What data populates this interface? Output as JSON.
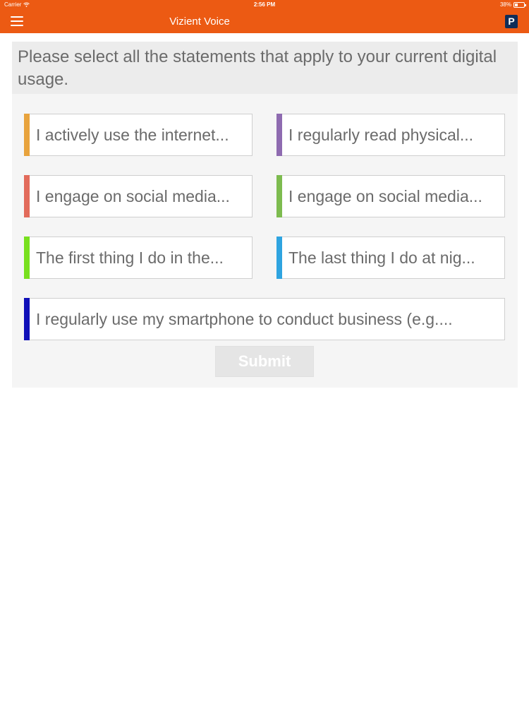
{
  "status_bar": {
    "carrier": "Carrier",
    "time": "2:56 PM",
    "battery": "38%"
  },
  "app_bar": {
    "title": "Vizient Voice",
    "logo_letter": "P",
    "accent_color": "#ec5a13"
  },
  "question": {
    "text": "Please select all the statements that apply to your current digital usage."
  },
  "options": [
    {
      "label": "I actively use the internet...",
      "color": "#e8a33d"
    },
    {
      "label": "I regularly read physical...",
      "color": "#8e6bb0"
    },
    {
      "label": "I engage on social media...",
      "color": "#e26b5b"
    },
    {
      "label": "I engage on social media...",
      "color": "#7dbb4f"
    },
    {
      "label": "The first thing I do in the...",
      "color": "#78e01e"
    },
    {
      "label": "The last thing I do at nig...",
      "color": "#2fa4e0"
    },
    {
      "label": "I regularly use my smartphone to conduct business (e.g....",
      "color": "#1010b8"
    }
  ],
  "submit": {
    "label": "Submit"
  }
}
